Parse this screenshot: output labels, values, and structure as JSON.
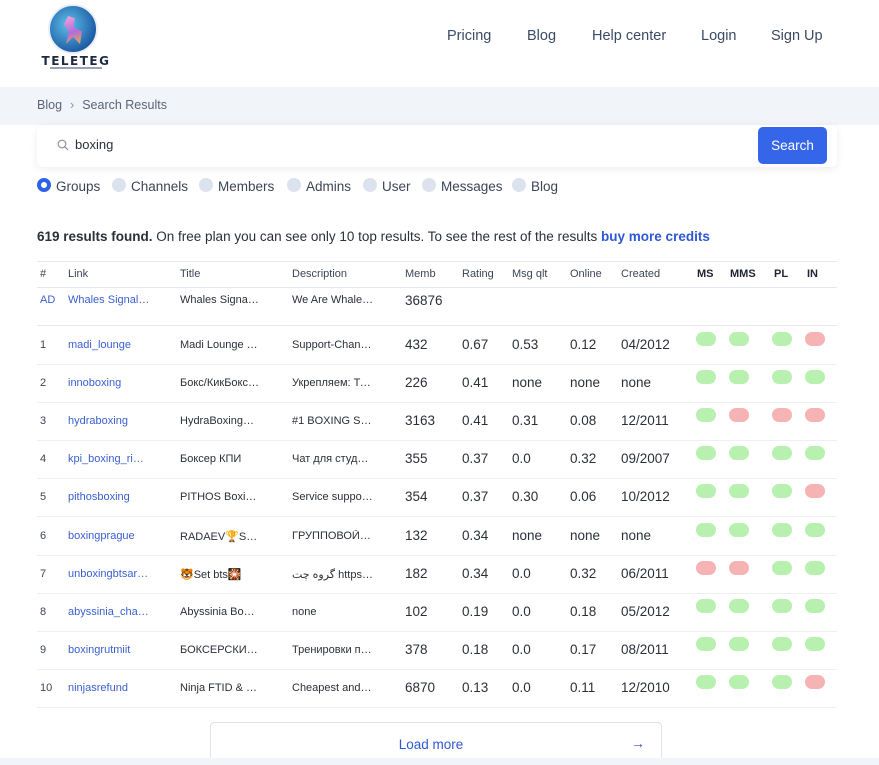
{
  "brand": {
    "name": "TELETEG"
  },
  "nav": [
    "Pricing",
    "Blog",
    "Help center",
    "Login",
    "Sign Up"
  ],
  "breadcrumb": {
    "items": [
      "Blog",
      "Search Results"
    ],
    "separator": "›"
  },
  "search": {
    "value": "boxing",
    "button_label": "Search"
  },
  "filters": {
    "options": [
      "Groups",
      "Channels",
      "Members",
      "Admins",
      "User",
      "Messages",
      "Blog"
    ],
    "selected": "Groups"
  },
  "summary": {
    "count_text": "619 results found.",
    "plan_text": " On free plan you can see only 10 top results. To see the rest of the results ",
    "link_text": "buy more credits"
  },
  "table": {
    "headers": [
      "#",
      "Link",
      "Title",
      "Description",
      "Memb",
      "Rating",
      "Msg qlt",
      "Online",
      "Created",
      "MS",
      "MMS",
      "PL",
      "IN"
    ],
    "rows": [
      {
        "num": "AD",
        "link": "Whales Signal…",
        "title": "Whales Signal…",
        "desc": "We Are Whale…",
        "memb": "36876",
        "rating": "",
        "msg": "",
        "online": "",
        "created": "",
        "flags": []
      },
      {
        "num": "1",
        "link": "madi_lounge",
        "title": "Madi Lounge …",
        "desc": "Support-Chan…",
        "memb": "432",
        "rating": "0.67",
        "msg": "0.53",
        "online": "0.12",
        "created": "04/2012",
        "flags": [
          "green",
          "green",
          "green",
          "red"
        ]
      },
      {
        "num": "2",
        "link": "innoboxing",
        "title": "Бокс/КикБокс…",
        "desc": "Укрепляем: Те…",
        "memb": "226",
        "rating": "0.41",
        "msg": "none",
        "online": "none",
        "created": "none",
        "flags": [
          "green",
          "green",
          "green",
          "green"
        ]
      },
      {
        "num": "3",
        "link": "hydraboxing",
        "title": "HydraBoxing™…",
        "desc": "#1 BOXING S…",
        "memb": "3163",
        "rating": "0.41",
        "msg": "0.31",
        "online": "0.08",
        "created": "12/2011",
        "flags": [
          "green",
          "red",
          "red",
          "red"
        ]
      },
      {
        "num": "4",
        "link": "kpi_boxing_ri…",
        "title": "Боксер КПИ",
        "desc": "Чат для студен…",
        "memb": "355",
        "rating": "0.37",
        "msg": "0.0",
        "online": "0.32",
        "created": "09/2007",
        "flags": [
          "green",
          "green",
          "green",
          "green"
        ]
      },
      {
        "num": "5",
        "link": "pithosboxing",
        "title": "PITHOS Boxin…",
        "desc": "Service suppo…",
        "memb": "354",
        "rating": "0.37",
        "msg": "0.30",
        "online": "0.06",
        "created": "10/2012",
        "flags": [
          "green",
          "green",
          "green",
          "red"
        ]
      },
      {
        "num": "6",
        "link": "boxingprague",
        "title": "RADAEV🏆SP…",
        "desc": "ГРУППОВОЙ…",
        "memb": "132",
        "rating": "0.34",
        "msg": "none",
        "online": "none",
        "created": "none",
        "flags": [
          "green",
          "green",
          "green",
          "green"
        ]
      },
      {
        "num": "7",
        "link": "unboxingbtsar…",
        "title": "🐯Set bts🎇",
        "desc": "گروه چت https:/…",
        "memb": "182",
        "rating": "0.34",
        "msg": "0.0",
        "online": "0.32",
        "created": "06/2011",
        "flags": [
          "red",
          "red",
          "green",
          "green"
        ]
      },
      {
        "num": "8",
        "link": "abyssinia_cha…",
        "title": "Abyssinia Boxi…",
        "desc": "none",
        "memb": "102",
        "rating": "0.19",
        "msg": "0.0",
        "online": "0.18",
        "created": "05/2012",
        "flags": [
          "green",
          "green",
          "green",
          "green"
        ]
      },
      {
        "num": "9",
        "link": "boxingrutmiit",
        "title": "БОКСЕРСКИ…",
        "desc": "Тренировки п…",
        "memb": "378",
        "rating": "0.18",
        "msg": "0.0",
        "online": "0.17",
        "created": "08/2011",
        "flags": [
          "green",
          "green",
          "green",
          "green"
        ]
      },
      {
        "num": "10",
        "link": "ninjasrefund",
        "title": "Ninja FTID & …",
        "desc": "Cheapest and…",
        "memb": "6870",
        "rating": "0.13",
        "msg": "0.0",
        "online": "0.11",
        "created": "12/2010",
        "flags": [
          "green",
          "green",
          "green",
          "red"
        ]
      }
    ]
  },
  "load_more": {
    "label": "Load more",
    "arrow": "→"
  },
  "colors": {
    "accent": "#3565e8",
    "link": "#3a5fcf",
    "ok": "#b8f0b0",
    "bad": "#f6b3b3",
    "band": "#f1f4f9"
  }
}
